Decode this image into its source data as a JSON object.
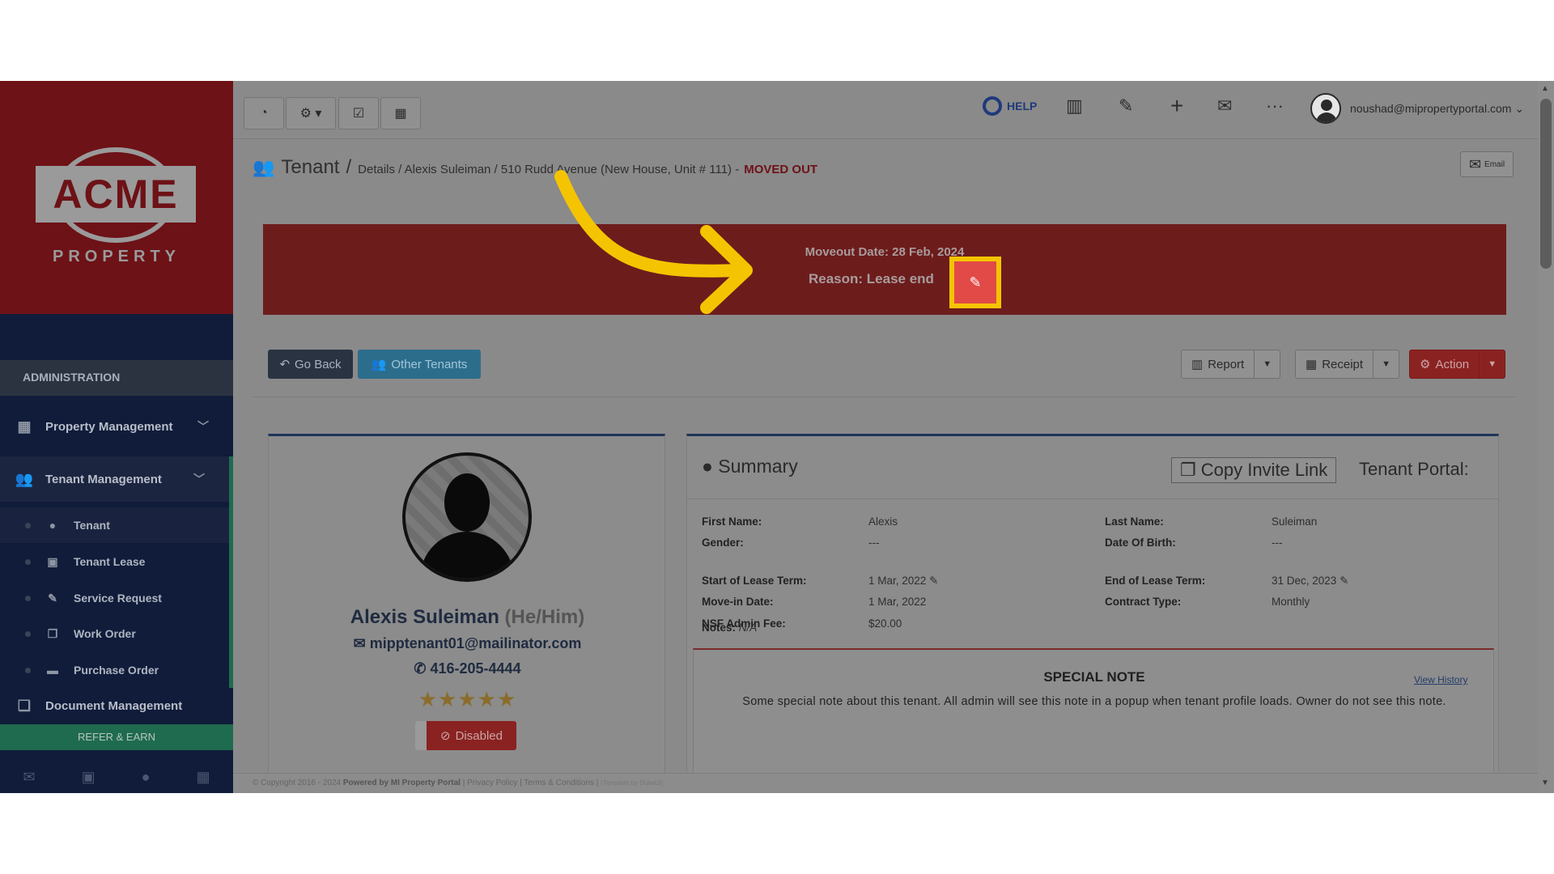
{
  "sidebar": {
    "logo_text": "ACME",
    "logo_sub": "PROPERTY",
    "section_label": "ADMINISTRATION",
    "groups": [
      {
        "label": "Property Management",
        "icon": "building-icon"
      },
      {
        "label": "Tenant Management",
        "icon": "users-icon"
      },
      {
        "label": "Document Management",
        "icon": "documents-icon"
      }
    ],
    "tenant_submenu": [
      {
        "label": "Tenant",
        "icon": "user-icon"
      },
      {
        "label": "Tenant Lease",
        "icon": "calendar-check-icon"
      },
      {
        "label": "Service Request",
        "icon": "wrench-icon"
      },
      {
        "label": "Work Order",
        "icon": "copy-icon"
      },
      {
        "label": "Purchase Order",
        "icon": "truck-icon"
      }
    ],
    "refer_label": "REFER & EARN"
  },
  "topbar": {
    "help_label": "HELP",
    "user_email": "noushad@mipropertyportal.com"
  },
  "page": {
    "title": "Tenant",
    "breadcrumb": "Details / Alexis Suleiman / 510 Rudd Avenue (New House, Unit # 111) -",
    "status": "MOVED OUT",
    "email_btn": "Email"
  },
  "banner": {
    "moveout_date": "Moveout Date: 28 Feb, 2024",
    "reason": "Reason: Lease end"
  },
  "actions": {
    "go_back": "Go Back",
    "other_tenants": "Other Tenants",
    "report": "Report",
    "receipt": "Receipt",
    "action": "Action"
  },
  "profile": {
    "name": "Alexis Suleiman",
    "pronouns": "(He/Him)",
    "email": "mipptenant01@mailinator.com",
    "phone": "416-205-4444",
    "rating": "★★★★★",
    "rating_value": 5,
    "rating_max": 5,
    "status_btn": "Disabled"
  },
  "summary": {
    "title": "Summary",
    "copy_invite": "Copy Invite Link",
    "tenant_portal": "Tenant Portal:",
    "fields_left": [
      {
        "label": "First Name:",
        "value": "Alexis"
      },
      {
        "label": "Gender:",
        "value": "---"
      },
      {
        "label": "Start of Lease Term:",
        "value": "1 Mar, 2022"
      },
      {
        "label": "Move-in Date:",
        "value": "1 Mar, 2022"
      },
      {
        "label": "NSF Admin Fee:",
        "value": "$20.00"
      }
    ],
    "fields_right": [
      {
        "label": "Last Name:",
        "value": "Suleiman"
      },
      {
        "label": "Date Of Birth:",
        "value": "---"
      },
      {
        "label": "End of Lease Term:",
        "value": "31 Dec, 2023"
      },
      {
        "label": "Contract Type:",
        "value": "Monthly"
      }
    ],
    "notes_label": "Notes:",
    "notes_value": "N/A"
  },
  "special_note": {
    "title": "SPECIAL NOTE",
    "view_history": "View History",
    "text": "Some special note about this tenant. All admin will see this note in a popup when tenant profile loads. Owner do not see this note."
  },
  "footer": {
    "copyright": "© Copyright 2016 - 2024",
    "powered": "Powered by MI Property Portal",
    "links": "| Privacy Policy | Terms & Conditions |",
    "credit": "(Template by DrawUI)"
  },
  "colors": {
    "highlight": "#f5c400",
    "arrow": "#f5c400",
    "banner": "#6d1c1c",
    "edit_button": "#e14a46"
  }
}
